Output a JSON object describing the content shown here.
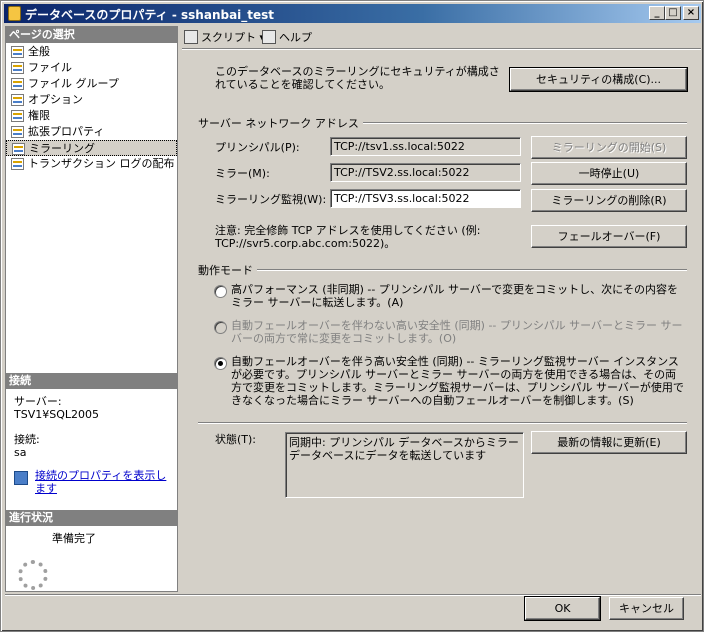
{
  "window": {
    "title": "データベースのプロパティ - sshanbai_test"
  },
  "left": {
    "page_select_header": "ページの選択",
    "nav_items": [
      "全般",
      "ファイル",
      "ファイル グループ",
      "オプション",
      "権限",
      "拡張プロパティ",
      "ミラーリング",
      "トランザクション ログの配布"
    ],
    "connection_header": "接続",
    "server_label": "サーバー:",
    "server_value": "TSV1¥SQL2005",
    "connection_label": "接続:",
    "connection_value": "sa",
    "view_props_link": "接続のプロパティを表示します",
    "progress_header": "進行状況",
    "progress_status": "準備完了"
  },
  "toolbar": {
    "script_label": "スクリプト ▾",
    "help_label": "ヘルプ"
  },
  "security": {
    "text": "このデータベースのミラーリングにセキュリティが構成されていることを確認してください。",
    "configure_button": "セキュリティの構成(C)..."
  },
  "network": {
    "group_label": "サーバー ネットワーク アドレス",
    "principal_label": "プリンシパル(P):",
    "principal_value": "TCP://tsv1.ss.local:5022",
    "mirror_label": "ミラー(M):",
    "mirror_value": "TCP://TSV2.ss.local:5022",
    "witness_label": "ミラーリング監視(W):",
    "witness_value": "TCP://TSV3.ss.local:5022",
    "start_button": "ミラーリングの開始(S)",
    "pause_button": "一時停止(U)",
    "remove_button": "ミラーリングの削除(R)",
    "note": "注意: 完全修飾 TCP アドレスを使用してください (例: TCP://svr5.corp.abc.com:5022)。",
    "failover_button": "フェールオーバー(F)"
  },
  "mode": {
    "group_label": "動作モード",
    "option1": "高パフォーマンス (非同期) -- プリンシパル サーバーで変更をコミットし、次にその内容をミラー サーバーに転送します。(A)",
    "option2": "自動フェールオーバーを伴わない高い安全性 (同期) -- プリンシパル サーバーとミラー サーバーの両方で常に変更をコミットします。(O)",
    "option3": "自動フェールオーバーを伴う高い安全性 (同期) -- ミラーリング監視サーバー インスタンスが必要です。プリンシパル サーバーとミラー サーバーの両方を使用できる場合は、その両方で変更をコミットします。ミラーリング監視サーバーは、プリンシパル サーバーが使用できなくなった場合にミラー サーバーへの自動フェールオーバーを制御します。(S)"
  },
  "status": {
    "label": "状態(T):",
    "value": "同期中: プリンシパル データベースからミラー データベースにデータを転送しています",
    "refresh_button": "最新の情報に更新(E)"
  },
  "footer": {
    "ok_button": "OK",
    "cancel_button": "キャンセル"
  }
}
